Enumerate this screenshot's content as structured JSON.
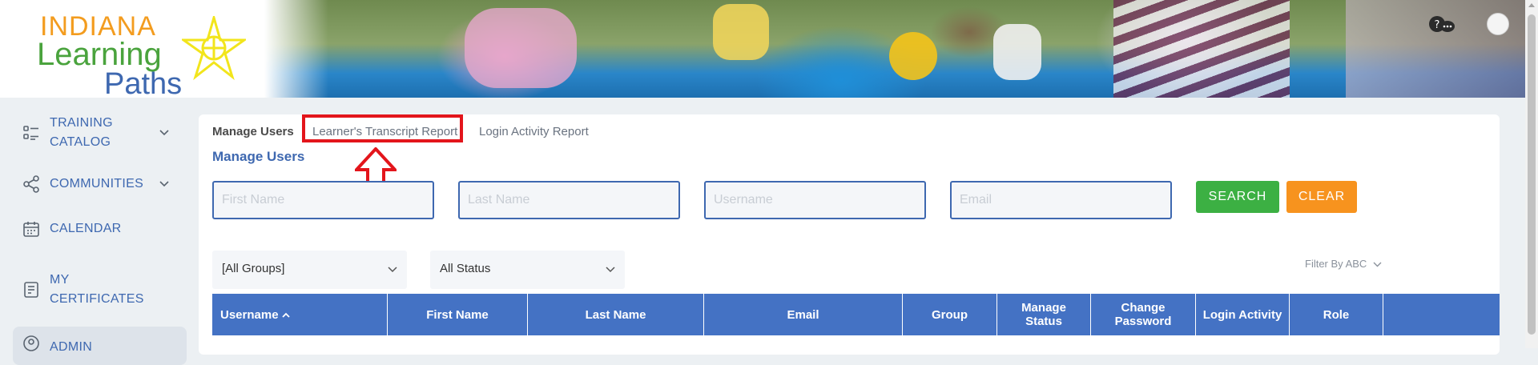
{
  "header": {
    "logo": {
      "line1": "INDIANA",
      "line2": "Learning",
      "line3": "Paths"
    },
    "help_icon": "help-chat-icon",
    "avatar_icon": "user-avatar-icon"
  },
  "sidebar": {
    "items": [
      {
        "label_line1": "TRAINING",
        "label_line2": "CATALOG",
        "icon": "catalog-list-icon",
        "expandable": true
      },
      {
        "label_line1": "COMMUNITIES",
        "label_line2": "",
        "icon": "share-network-icon",
        "expandable": true
      },
      {
        "label_line1": "CALENDAR",
        "label_line2": "",
        "icon": "calendar-icon",
        "expandable": false
      },
      {
        "label_line1": "MY",
        "label_line2": "CERTIFICATES",
        "icon": "certificate-icon",
        "expandable": false
      },
      {
        "label_line1": "ADMIN",
        "label_line2": "",
        "icon": "user-circle-icon",
        "expandable": false
      }
    ]
  },
  "tabs": [
    "Manage Users",
    "Learner's Transcript Report",
    "Login Activity Report"
  ],
  "page_title": "Manage Users",
  "filters": {
    "first_name_placeholder": "First Name",
    "last_name_placeholder": "Last Name",
    "username_placeholder": "Username",
    "email_placeholder": "Email",
    "search_label": "SEARCH",
    "clear_label": "CLEAR",
    "group_selected": "[All Groups]",
    "status_selected": "All Status",
    "filter_abc": "Filter By ABC"
  },
  "table": {
    "headers": [
      {
        "line1": "Username",
        "line2": ""
      },
      {
        "line1": "First Name",
        "line2": ""
      },
      {
        "line1": "Last Name",
        "line2": ""
      },
      {
        "line1": "Email",
        "line2": ""
      },
      {
        "line1": "Group",
        "line2": ""
      },
      {
        "line1": "Manage",
        "line2": "Status"
      },
      {
        "line1": "Change",
        "line2": "Password"
      },
      {
        "line1": "Login Activity",
        "line2": ""
      },
      {
        "line1": "Role",
        "line2": ""
      },
      {
        "line1": "",
        "line2": ""
      }
    ]
  },
  "colors": {
    "primary_blue": "#3e68b0",
    "table_header": "#4472c4",
    "search_green": "#3cb043",
    "clear_orange": "#f7931e",
    "highlight_red": "#e3151b"
  }
}
